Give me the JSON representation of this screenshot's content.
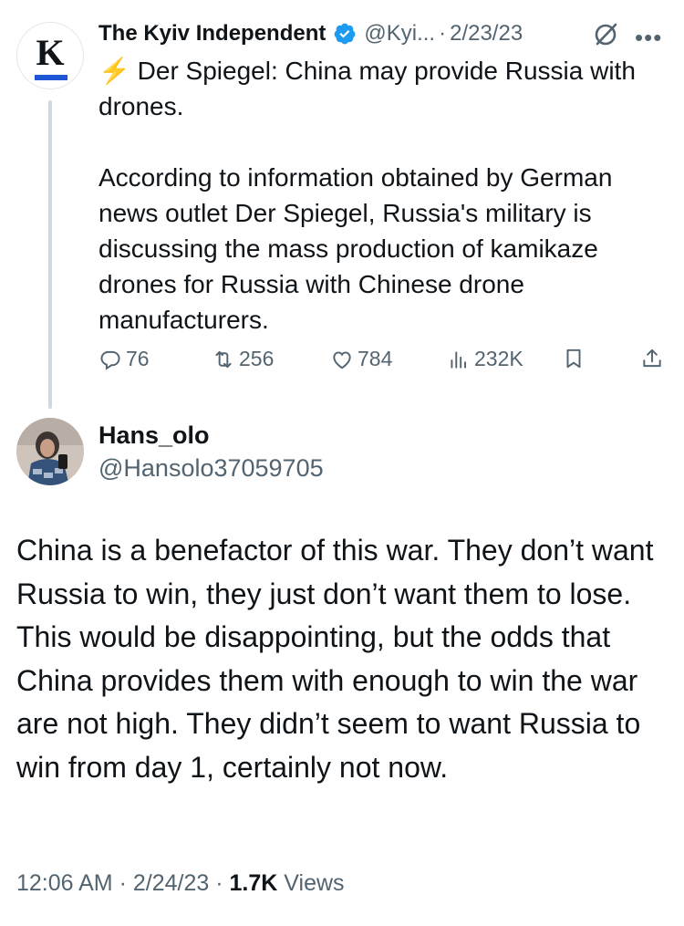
{
  "parent_tweet": {
    "avatar_letter": "K",
    "author_name": "The Kyiv Independent",
    "handle": "@Kyi...",
    "separator": "·",
    "date": "2/23/23",
    "headline_icon": "⚡",
    "headline": "Der Spiegel: China may provide Russia with drones.",
    "body": "According to information obtained by German news outlet Der Spiegel, Russia's military is discussing the mass production of kamikaze drones for Russia with Chinese drone manufacturers.",
    "stats": {
      "replies": "76",
      "reposts": "256",
      "likes": "784",
      "views": "232K"
    },
    "icons": [
      "verified-badge-icon",
      "grok-icon",
      "more-icon",
      "reply-icon",
      "repost-icon",
      "like-icon",
      "views-icon",
      "bookmark-icon",
      "share-icon"
    ],
    "colors": {
      "verified": "#1d9bf0",
      "secondary_text": "#536471",
      "thread_line": "#cfd9de",
      "logo_bar": "#1d56d6"
    }
  },
  "reply_tweet": {
    "author_name": "Hans_olo",
    "handle": "@Hansolo37059705",
    "body": "China is a benefactor of this war. They don’t want Russia to win, they just don’t want them to lose. This would be disappointing, but the odds that China provides them with enough to win the war are not high. They didn’t seem to want Russia to win from day 1, certainly not now.",
    "time": "12:06 AM",
    "date": "2/24/23",
    "separator": "·",
    "views_count": "1.7K",
    "views_label": "Views"
  }
}
